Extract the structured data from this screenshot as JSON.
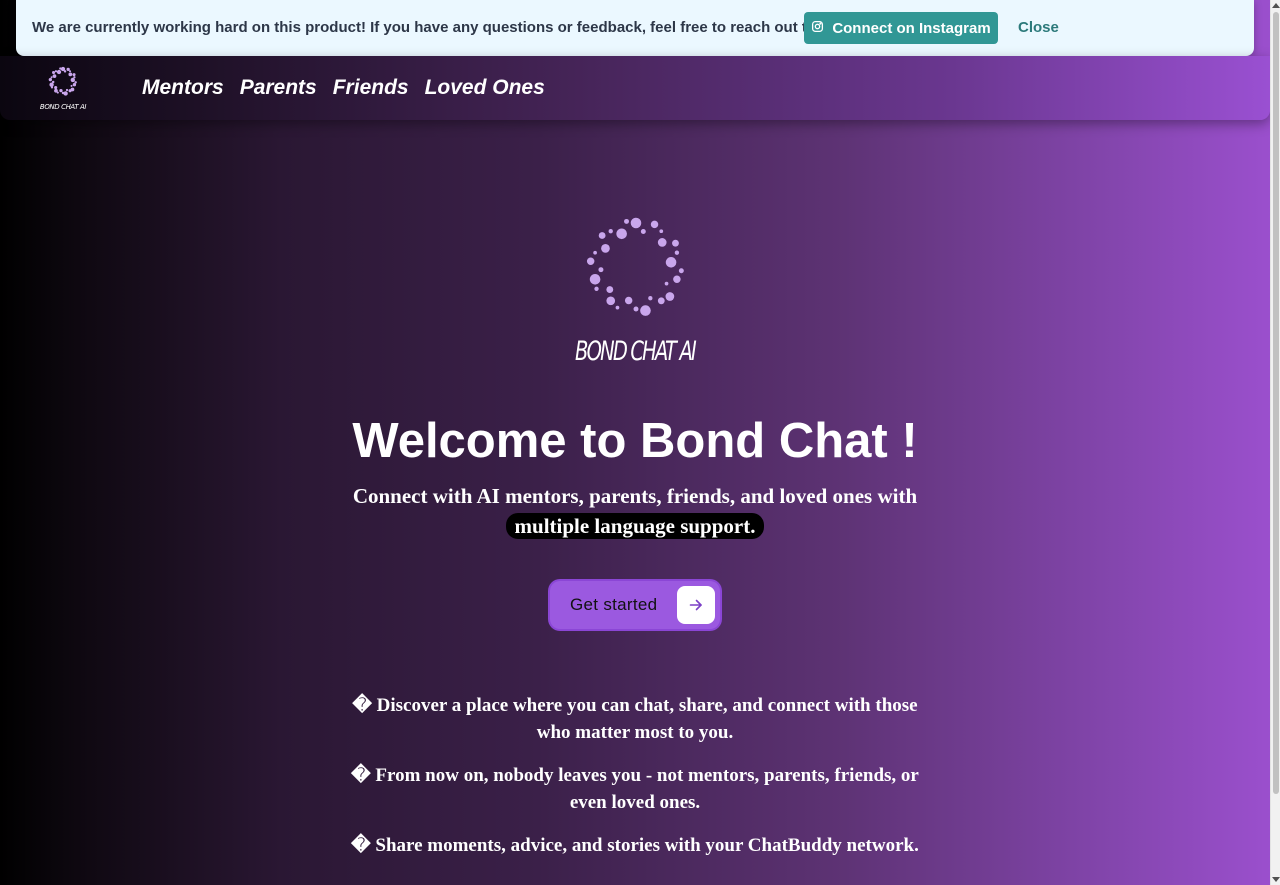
{
  "banner": {
    "message": "We are currently working hard on this product! If you have any questions or feedback, feel free to reach out to us.",
    "instagram_button": "Connect on Instagram",
    "close_button": "Close"
  },
  "nav": {
    "logo_text": "BOND CHAT AI",
    "links": [
      "Mentors",
      "Parents",
      "Friends",
      "Loved Ones"
    ]
  },
  "hero": {
    "logo_text": "BOND CHAT AI",
    "title": "Welcome to Bond Chat !",
    "subtitle_main": "Connect with AI mentors, parents, friends, and loved ones with",
    "subtitle_highlight": "multiple language support.",
    "cta_label": "Get started"
  },
  "features": [
    "� Discover a place where you can chat, share, and connect with those who matter most to you.",
    "� From now on, nobody leaves you - not mentors, parents, friends, or even loved ones.",
    "� Share moments, advice, and stories with your ChatBuddy network."
  ],
  "colors": {
    "banner_bg": "#ebf8ff",
    "instagram_button": "#319795",
    "close_text": "#2c7a7b",
    "cta_bg": "#9b59e0",
    "logo_dots": "#c9a6ec"
  },
  "icons": {
    "instagram": "instagram-icon",
    "cta_arrow": "arrow-right-icon"
  }
}
